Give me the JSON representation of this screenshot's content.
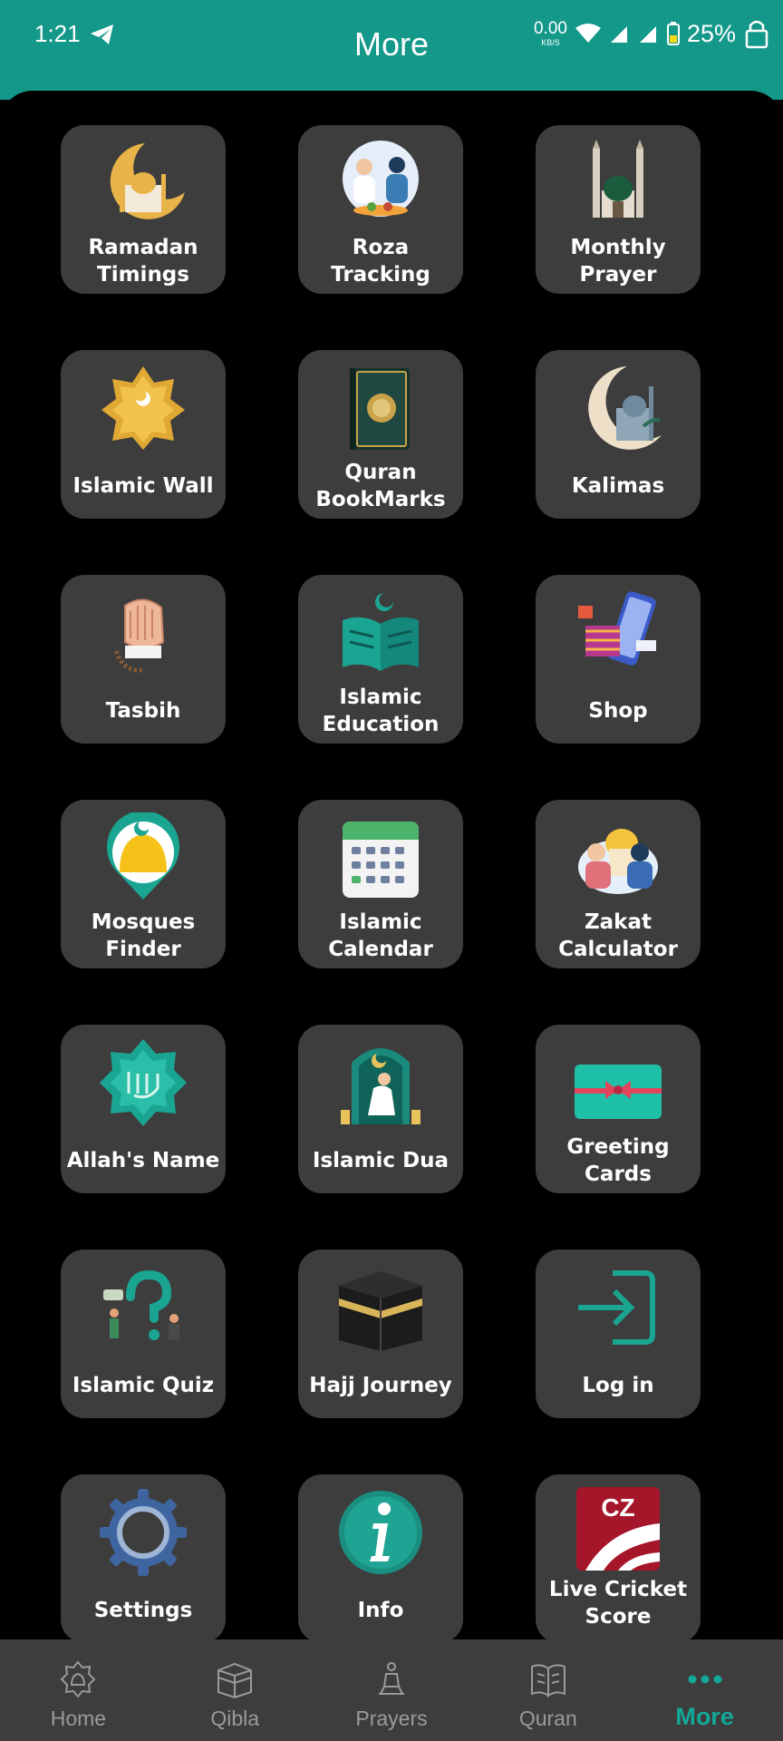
{
  "status": {
    "time": "1:21",
    "speed_value": "0.00",
    "speed_unit": "KB/S",
    "battery": "25%"
  },
  "header": {
    "title": "More"
  },
  "grid": [
    {
      "label": "Ramadan Timings",
      "icon": "crescent-mosque-icon"
    },
    {
      "label": "Roza Tracking",
      "icon": "iftar-people-icon"
    },
    {
      "label": "Monthly Prayer",
      "icon": "minaret-dome-icon"
    },
    {
      "label": "Islamic Wall",
      "icon": "gold-star-mosque-icon"
    },
    {
      "label": "Quran BookMarks",
      "icon": "quran-book-icon"
    },
    {
      "label": "Kalimas",
      "icon": "crescent-moon-mosque-icon"
    },
    {
      "label": "Tasbih",
      "icon": "praying-hands-beads-icon"
    },
    {
      "label": "Islamic Education",
      "icon": "open-book-crescent-icon"
    },
    {
      "label": "Shop",
      "icon": "phone-shopping-icon"
    },
    {
      "label": "Mosques Finder",
      "icon": "mosque-location-pin-icon"
    },
    {
      "label": "Islamic Calendar",
      "icon": "calendar-icon"
    },
    {
      "label": "Zakat Calculator",
      "icon": "zakat-charity-icon"
    },
    {
      "label": "Allah's Name",
      "icon": "allah-calligraphy-star-icon"
    },
    {
      "label": "Islamic Dua",
      "icon": "man-praying-icon"
    },
    {
      "label": "Greeting Cards",
      "icon": "gift-card-icon"
    },
    {
      "label": "Islamic Quiz",
      "icon": "question-mark-people-icon"
    },
    {
      "label": "Hajj Journey",
      "icon": "kaaba-icon"
    },
    {
      "label": "Log in",
      "icon": "login-arrow-icon"
    },
    {
      "label": "Settings",
      "icon": "gear-icon"
    },
    {
      "label": "Info",
      "icon": "info-icon"
    },
    {
      "label": "Live Cricket Score",
      "icon": "cricket-ball-icon",
      "badge": "CZ"
    }
  ],
  "nav": [
    {
      "label": "Home",
      "icon": "home-mosque-icon"
    },
    {
      "label": "Qibla",
      "icon": "kaaba-outline-icon"
    },
    {
      "label": "Prayers",
      "icon": "prayer-person-icon"
    },
    {
      "label": "Quran",
      "icon": "quran-outline-icon"
    },
    {
      "label": "More",
      "icon": "more-dots-icon",
      "active": true
    }
  ],
  "colors": {
    "accent": "#14988a",
    "card": "#3d3d3d",
    "active_nav": "#14a899"
  }
}
